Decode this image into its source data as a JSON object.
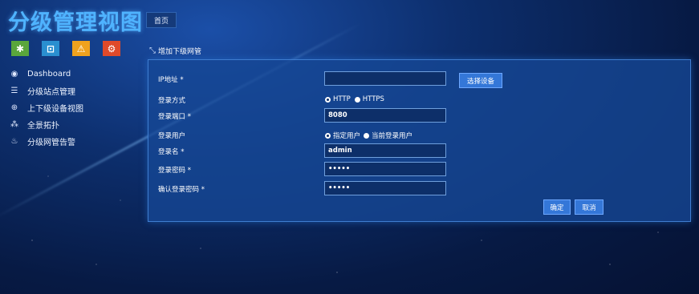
{
  "header": {
    "app_title": "分级管理视图",
    "home_tab": "首页"
  },
  "quick_icons": [
    {
      "icon": "asterisk-icon",
      "color": "#5aa63c"
    },
    {
      "icon": "network-icon",
      "color": "#2a8fd0"
    },
    {
      "icon": "warning-icon",
      "color": "#f0a21e"
    },
    {
      "icon": "cogs-icon",
      "color": "#e04a2a"
    }
  ],
  "sidebar": {
    "items": [
      {
        "label": "Dashboard",
        "icon": "dashboard-icon"
      },
      {
        "label": "分级站点管理",
        "icon": "list-icon"
      },
      {
        "label": "上下级设备视图",
        "icon": "globe-icon"
      },
      {
        "label": "全景拓扑",
        "icon": "topology-icon"
      },
      {
        "label": "分级网管告警",
        "icon": "alarm-icon"
      }
    ]
  },
  "breadcrumb": {
    "label": "增加下级网管",
    "icon": "expand-icon"
  },
  "form": {
    "ip_label": "IP地址 *",
    "ip_value": "",
    "select_device": "选择设备",
    "login_method_label": "登录方式",
    "login_method_options": [
      "HTTP",
      "HTTPS"
    ],
    "login_method_selected": "HTTP",
    "port_label": "登录端口 *",
    "port_value": "8080",
    "login_user_label": "登录用户",
    "login_user_options": [
      "指定用户",
      "当前登录用户"
    ],
    "login_user_selected": "指定用户",
    "username_label": "登录名 *",
    "username_value": "admin",
    "password_label": "登录密码 *",
    "password_value": "•••••",
    "confirm_label": "确认登录密码 *",
    "confirm_value": "•••••",
    "ok": "确定",
    "cancel": "取消"
  }
}
